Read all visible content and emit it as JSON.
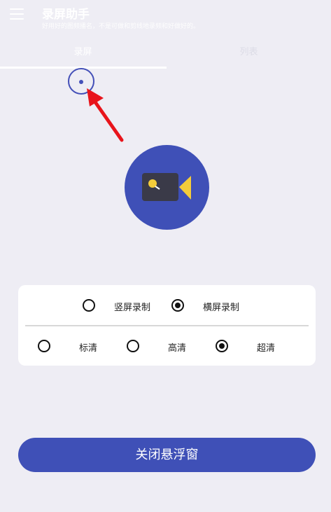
{
  "header": {
    "title": "录屏助手",
    "subtitle": "好用好的图频播名，不是可做和剪线地录频和好做好的。"
  },
  "tabs": [
    {
      "label": "录屏",
      "selected": true
    },
    {
      "label": "列表",
      "selected": false
    }
  ],
  "orientation": {
    "options": [
      {
        "label": "竖屏录制",
        "checked": false
      },
      {
        "label": "横屏录制",
        "checked": true
      }
    ]
  },
  "quality": {
    "options": [
      {
        "label": "标清",
        "checked": false
      },
      {
        "label": "高清",
        "checked": false
      },
      {
        "label": "超清",
        "checked": true
      }
    ]
  },
  "actions": {
    "close_float_label": "关闭悬浮窗"
  },
  "colors": {
    "accent": "#3f50b7",
    "background": "#eeedf4",
    "arrow": "#e8141b",
    "camera_body": "#3a3a48",
    "camera_lens": "#f4cc3a"
  },
  "icons": [
    "menu-icon",
    "float-ball-icon",
    "pointer-arrow-icon",
    "video-camera-icon"
  ]
}
